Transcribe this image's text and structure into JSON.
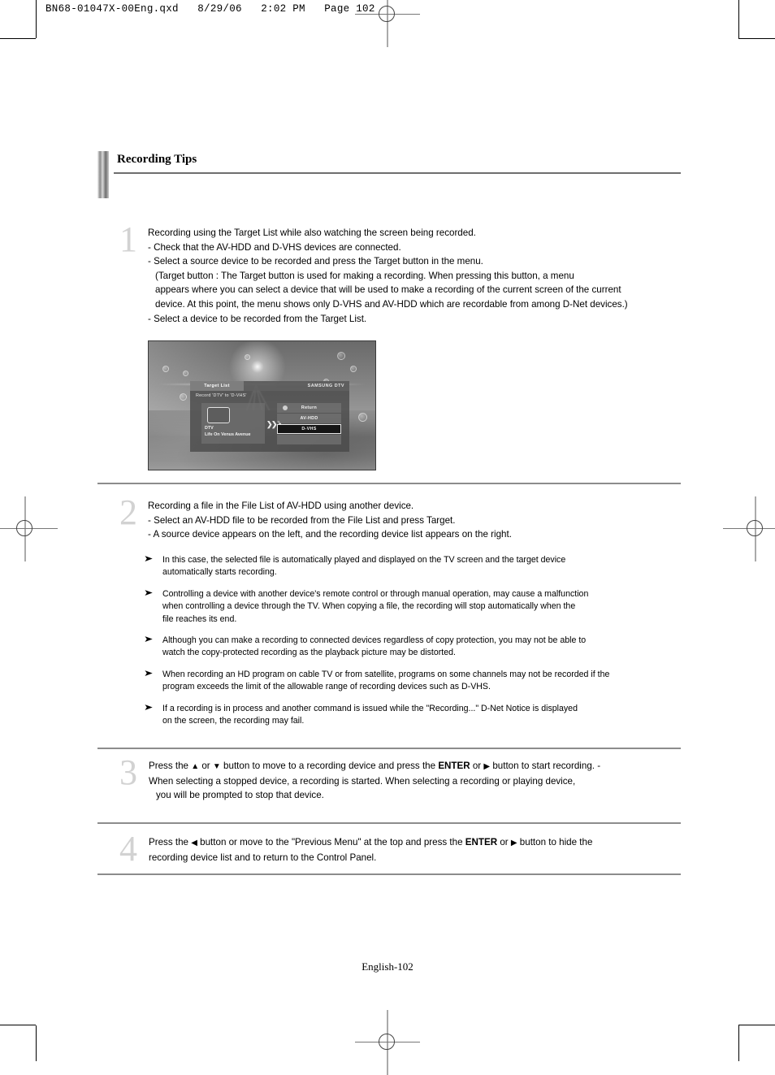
{
  "file_header": "BN68-01047X-00Eng.qxd   8/29/06   2:02 PM   Page 102",
  "section": {
    "title": "Recording Tips"
  },
  "steps": [
    {
      "number": "1",
      "lines": [
        "Recording using the Target List while also watching the screen being recorded.",
        "- Check that the AV-HDD and D-VHS devices are connected.",
        "- Select a source device to be recorded and press the Target button in the menu.",
        "(Target button : The Target button is used for making a recording. When pressing this button, a menu",
        "appears where you can select a device that will be used to make a recording of the current screen of the current",
        "device. At this point, the menu shows only D-VHS and AV-HDD which are recordable from among D-Net devices.)",
        "- Select a device to be recorded from the Target List."
      ]
    },
    {
      "number": "2",
      "lines": [
        "Recording a file in the File List of AV-HDD using another device.",
        "-  Select an AV-HDD file to be recorded from the File List and press Target.",
        "-  A source device appears on the left, and the recording device list appears on the right."
      ]
    },
    {
      "number": "3",
      "segments": {
        "a": "Press the",
        "up_glyph": "▲",
        "b": "or",
        "down_glyph": "▼",
        "c": "button to move to a recording device and press the",
        "enter": "ENTER",
        "d": "or",
        "right_glyph": "▶",
        "e": "button to start recording. -",
        "line2": "When selecting a stopped device, a recording is started. When selecting a recording or playing device,",
        "line3": "you will be prompted to stop that device."
      }
    },
    {
      "number": "4",
      "segments": {
        "a": "Press the",
        "left_glyph": "◀",
        "b": "button or move to the \"Previous Menu\" at the top and press the",
        "enter": "ENTER",
        "c": "or",
        "right_glyph": "▶",
        "d": "button to hide the",
        "line2": "recording device list and to return to the Control Panel."
      }
    }
  ],
  "notes": {
    "marker": "➤",
    "items": [
      [
        "In this case, the selected file is automatically played and displayed on the TV screen and the target device",
        "automatically starts recording."
      ],
      [
        "Controlling a device with another device's remote control or through manual operation, may cause a malfunction",
        "when controlling a device through the TV. When copying a file, the recording will stop automatically when the",
        "file reaches its end."
      ],
      [
        "Although you can make a recording to connected devices regardless of copy protection, you may not be able to",
        "watch the copy-protected recording as the playback picture may be distorted."
      ],
      [
        "When recording an HD program on cable TV or from satellite, programs on some channels may not be recorded if the",
        "program exceeds the limit of the allowable range of recording devices such as D-VHS."
      ],
      [
        "If a recording is in process and another command is issued while the \"Recording...\" D-Net Notice is displayed",
        "on the screen, the recording may fail."
      ]
    ]
  },
  "figure": {
    "tab_label": "Target  List",
    "brand_label": "SAMSUNG DTV",
    "subtitle": "Record 'DTV' to 'D-VHS'",
    "source": {
      "name": "DTV",
      "program": "Life On Venus Avenue"
    },
    "arrows": "❯❯❯",
    "device_list": [
      {
        "label": "Return",
        "selected": false,
        "has_icon": true
      },
      {
        "label": "AV-HDD",
        "selected": false,
        "has_icon": false
      },
      {
        "label": "D-VHS",
        "selected": true,
        "has_icon": false
      },
      {
        "label": "",
        "selected": false,
        "has_icon": false
      }
    ]
  },
  "footer": {
    "page_label": "English-102"
  }
}
